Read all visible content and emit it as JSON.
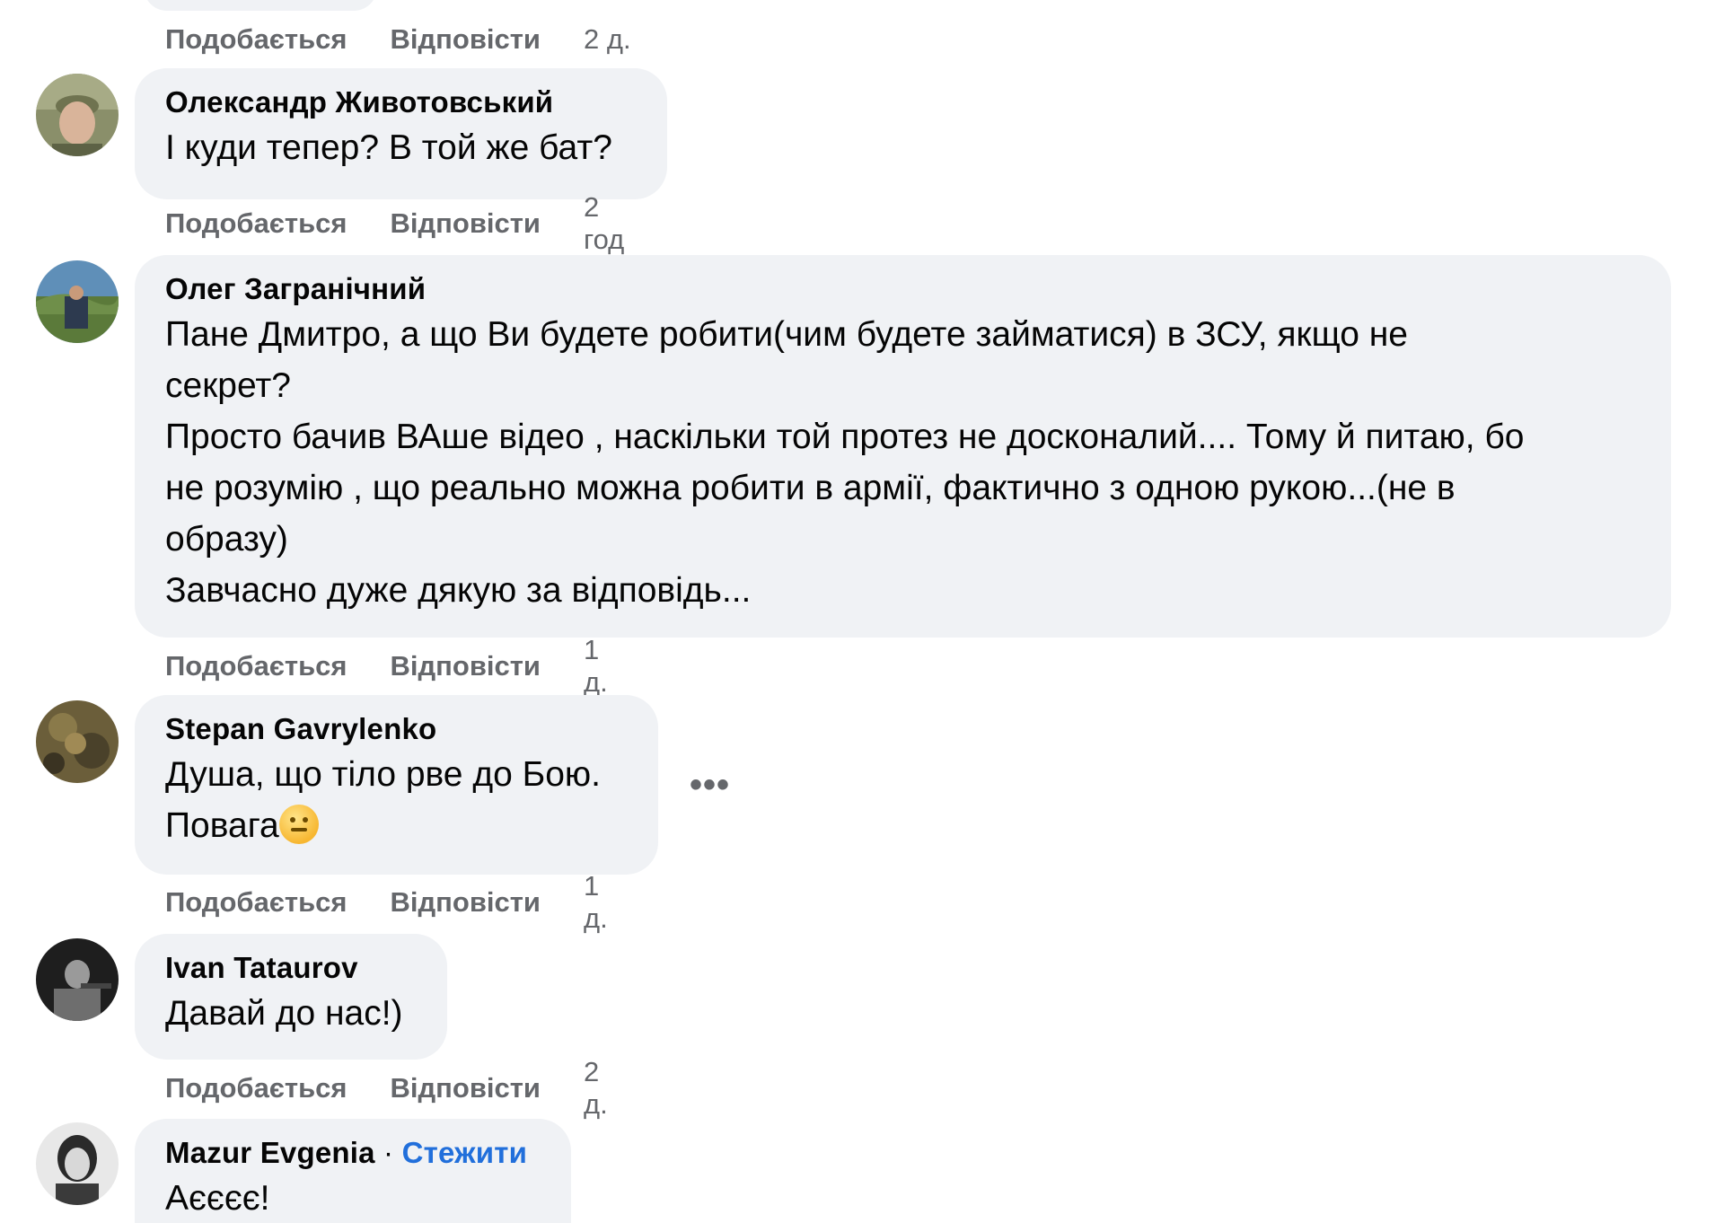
{
  "colors": {
    "bubble": "#f0f2f5",
    "meta": "#65676b",
    "link": "#216fdb"
  },
  "prev": {
    "like": "Подобається",
    "reply": "Відповісти",
    "time": "2 д."
  },
  "comments": [
    {
      "author": "Олександр Животовський",
      "text": "І куди тепер? В той же бат?",
      "like": "Подобається",
      "reply": "Відповісти",
      "time": "2 год"
    },
    {
      "author": "Олег Загранічний",
      "text": "Пане Дмитро, а що Ви будете робити(чим будете займатися) в ЗСУ, якщо не\nсекрет?\nПросто бачив ВАше відео , наскільки той протез не досконалий.... Тому й питаю, бо\nне розумію , що реально можна робити в армії, фактично з одною рукою...(не в\nобразу)\nЗавчасно дуже дякую за відповідь...",
      "like": "Подобається",
      "reply": "Відповісти",
      "time": "1 д."
    },
    {
      "author": "Stepan Gavrylenko",
      "text_line1": "Душа, що тіло рве до Бою.",
      "text_line2": "Повага",
      "emoji": "saluting-face-emoji",
      "more": "•••",
      "like": "Подобається",
      "reply": "Відповісти",
      "time": "1 д."
    },
    {
      "author": "Ivan Tataurov",
      "text": "Давай до нас!)",
      "like": "Подобається",
      "reply": "Відповісти",
      "time": "2 д."
    },
    {
      "author": "Mazur Evgenia",
      "separator": "·",
      "follow": "Стежити",
      "text": "Аєєєє!"
    }
  ]
}
